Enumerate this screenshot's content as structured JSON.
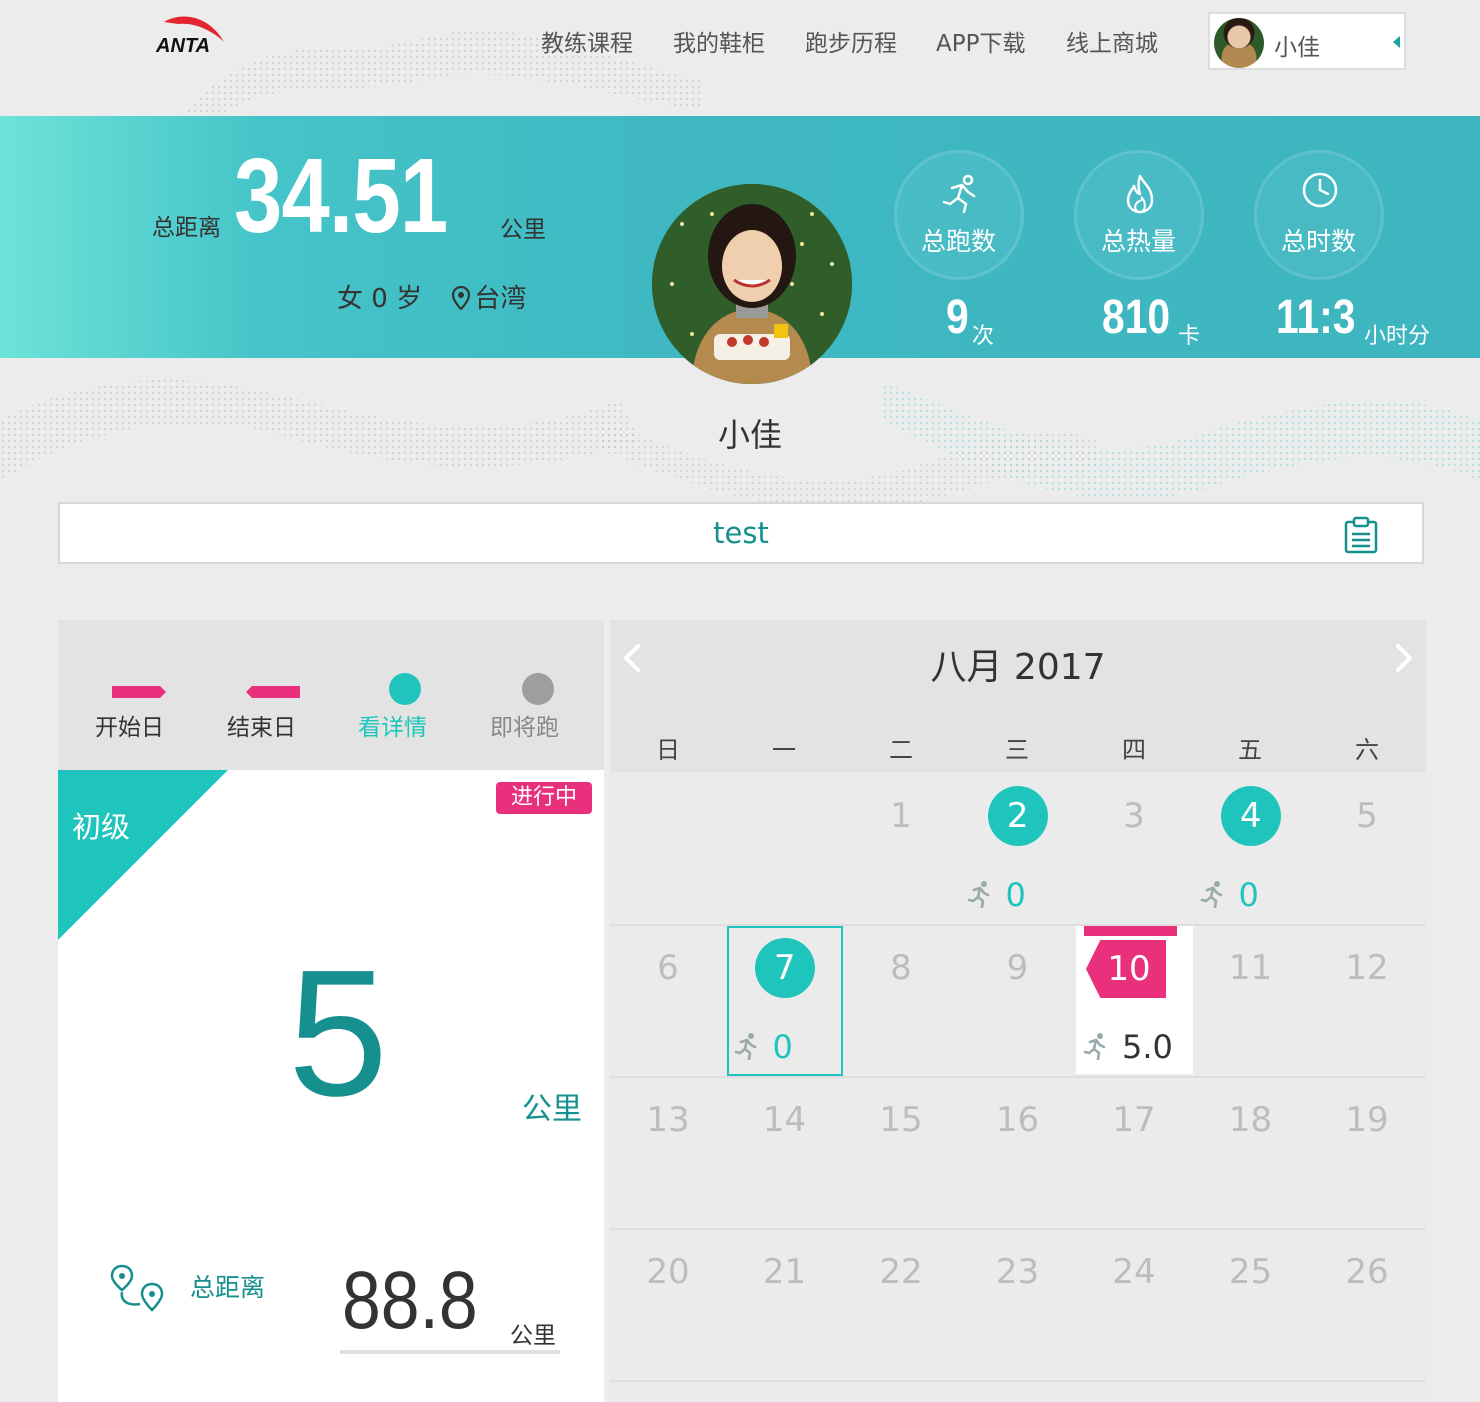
{
  "nav": {
    "logo_text": "ANTA",
    "items": [
      "教练课程",
      "我的鞋柜",
      "跑步历程",
      "APP下载",
      "线上商城"
    ],
    "user_name": "小佳"
  },
  "colors": {
    "accent": "#1fc5bd",
    "dark_teal": "#15908e",
    "pink": "#e8307c",
    "banner": "#3fb8c2"
  },
  "banner": {
    "distance_label": "总距离",
    "distance_value": "34.51",
    "distance_unit": "公里",
    "gender_age": "女 0 岁",
    "location": "台湾",
    "profile_name": "小佳",
    "stats": [
      {
        "label": "总跑数",
        "value": "9",
        "unit": "次",
        "icon": "runner-icon"
      },
      {
        "label": "总热量",
        "value": "810",
        "unit": "卡",
        "icon": "flame-icon"
      },
      {
        "label": "总时数",
        "value": "11:3",
        "unit": "小时分",
        "icon": "clock-icon"
      }
    ]
  },
  "plan": {
    "title": "test",
    "icon": "clipboard-icon"
  },
  "legend": [
    {
      "label": "开始日",
      "color": "#e8307c"
    },
    {
      "label": "结束日",
      "color": "#e8307c"
    },
    {
      "label": "看详情",
      "color": "#1fc5bd"
    },
    {
      "label": "即将跑",
      "color": "#9e9e9e"
    }
  ],
  "level": {
    "name": "初级",
    "status": "进行中",
    "goal_value": "5",
    "goal_unit": "公里",
    "total_label": "总距离",
    "total_value": "88.8",
    "total_unit": "公里"
  },
  "calendar": {
    "title": "八月 2017",
    "weekdays": [
      "日",
      "一",
      "二",
      "三",
      "四",
      "五",
      "六"
    ],
    "weeks": [
      [
        "",
        "",
        "1",
        "2",
        "3",
        "4",
        "5"
      ],
      [
        "6",
        "7",
        "8",
        "9",
        "10",
        "11",
        "12"
      ],
      [
        "13",
        "14",
        "15",
        "16",
        "17",
        "18",
        "19"
      ],
      [
        "20",
        "21",
        "22",
        "23",
        "24",
        "25",
        "26"
      ]
    ],
    "run_days": {
      "2": "0",
      "4": "0",
      "7": "0",
      "10": "5.0"
    },
    "start_day": "10",
    "selected_day": "7"
  }
}
